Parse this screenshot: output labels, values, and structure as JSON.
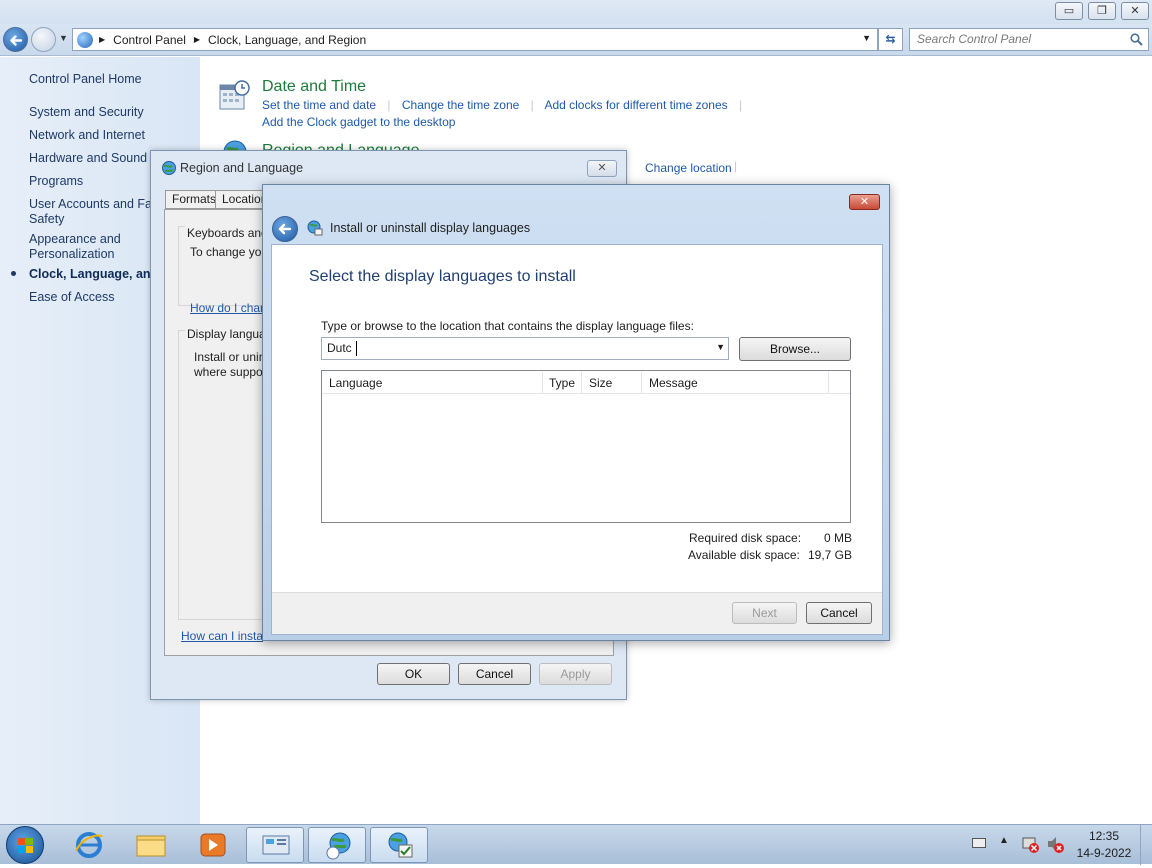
{
  "window": {
    "minimize_glyph": "▭",
    "restore_glyph": "❐",
    "close_glyph": "✕"
  },
  "address_bar": {
    "crumbs": [
      "Control Panel",
      "Clock, Language, and Region"
    ],
    "search_placeholder": "Search Control Panel"
  },
  "sidebar": {
    "items": [
      {
        "label": "Control Panel Home"
      },
      {
        "label": "System and Security"
      },
      {
        "label": "Network and Internet"
      },
      {
        "label": "Hardware and Sound"
      },
      {
        "label": "Programs"
      },
      {
        "label": "User Accounts and Family Safety"
      },
      {
        "label": "Appearance and Personalization"
      },
      {
        "label": "Clock, Language, and Region",
        "current": true
      },
      {
        "label": "Ease of Access"
      }
    ],
    "item0": "Control Panel Home",
    "item1": "System and Security",
    "item2": "Network and Internet",
    "item3": "Hardware and Sound",
    "item4": "Programs",
    "item5a": "User Accounts and Fam",
    "item5b": "Safety",
    "item6a": "Appearance and",
    "item6b": "Personalization",
    "item7": "Clock, Language, and R",
    "item8": "Ease of Access"
  },
  "main": {
    "date_time": {
      "title": "Date and Time",
      "links": [
        "Set the time and date",
        "Change the time zone",
        "Add clocks for different time zones"
      ],
      "link0": "Set the time and date",
      "link1": "Change the time zone",
      "link2": "Add clocks for different time zones",
      "link3": "Add the Clock gadget to the desktop"
    },
    "region_language": {
      "title": "Region and Language",
      "change_location": "Change location"
    }
  },
  "region_dialog": {
    "title": "Region and Language",
    "tabs": [
      "Formats",
      "Location"
    ],
    "tab0": "Formats",
    "tab1": "Location",
    "keyboards_heading": "Keyboards and",
    "keyboards_text": "To change yo",
    "keyboards_link": "How do I char",
    "display_heading": "Display langua",
    "display_text1": "Install or unin",
    "display_text2": "where suppo",
    "bottom_link": "How can I insta",
    "ok": "OK",
    "cancel": "Cancel",
    "apply": "Apply"
  },
  "install_dialog": {
    "title": "Install or uninstall display languages",
    "heading": "Select the display languages to install",
    "prompt": "Type or browse to the location that contains the display language files:",
    "path_value": "Dutc",
    "browse": "Browse...",
    "columns": [
      "Language",
      "Type",
      "Size",
      "Message"
    ],
    "col0": "Language",
    "col1": "Type",
    "col2": "Size",
    "col3": "Message",
    "required_label": "Required disk space:",
    "required_value": "0 MB",
    "available_label": "Available disk space:",
    "available_value": "19,7 GB",
    "next": "Next",
    "cancel": "Cancel"
  },
  "taskbar": {
    "time": "12:35",
    "date": "14-9-2022"
  }
}
